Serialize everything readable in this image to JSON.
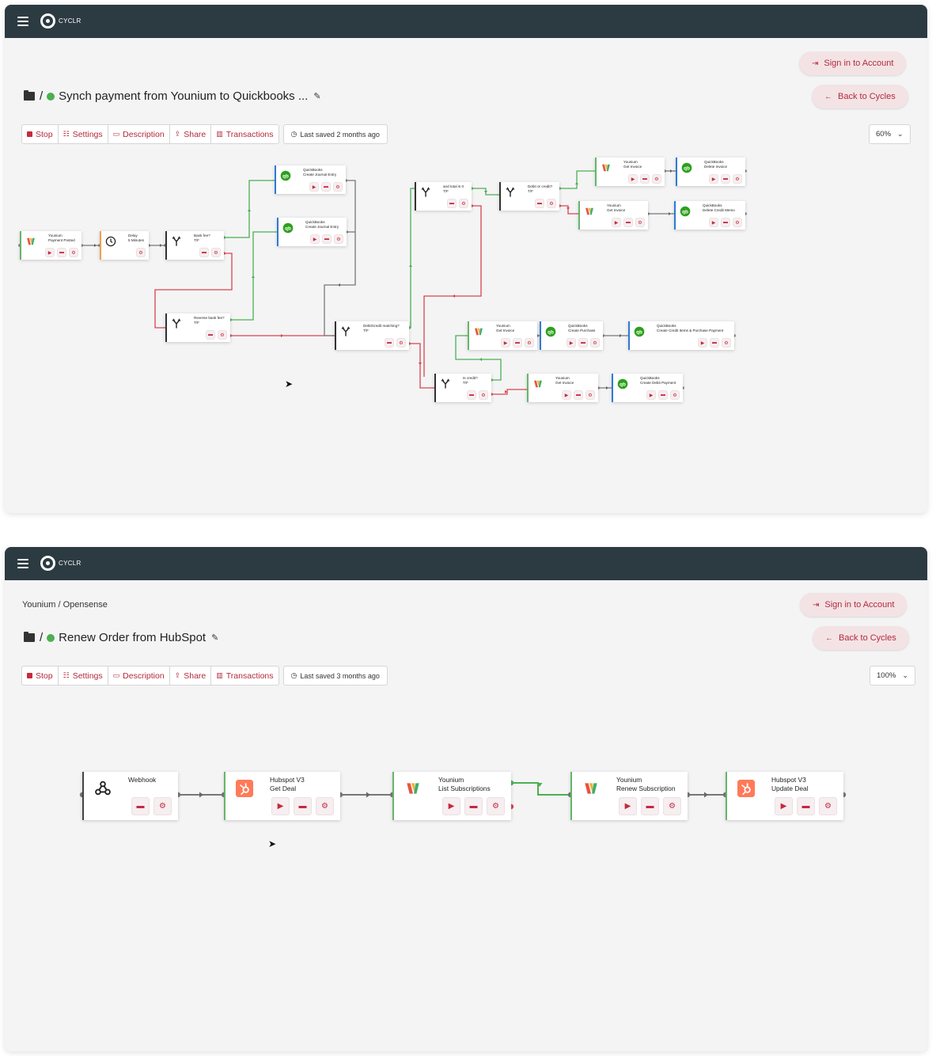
{
  "colors": {
    "topbar": "#2c3a42",
    "accent": "#b22a3c",
    "success": "#4caf50",
    "failure": "#d9434f",
    "quickbooks": "#2ca01c",
    "hubspot": "#ff7a59"
  },
  "app": {
    "logo_text": "CYCLR"
  },
  "screen1": {
    "sign_in": "Sign in to Account",
    "back": "Back to Cycles",
    "title": "Synch payment from Younium to Quickbooks ...",
    "toolbar": {
      "stop": "Stop",
      "settings": "Settings",
      "description": "Description",
      "share": "Share",
      "transactions": "Transactions"
    },
    "last_saved": "Last saved 2 months ago",
    "zoom": "60%",
    "nodes": [
      {
        "line1": "Younium",
        "line2": "Payment Posted",
        "icon": "younium-icon"
      },
      {
        "line1": "Delay",
        "line2": "5 Minutes",
        "icon": "clock-icon"
      },
      {
        "line1": "Bank fee?",
        "line2": "T/F",
        "icon": "fork-icon"
      },
      {
        "line1": "QuickBooks",
        "line2": "Create Journal Entry",
        "icon": "quickbooks-icon"
      },
      {
        "line1": "QuickBooks",
        "line2": "Create Journal Entry",
        "icon": "quickbooks-icon"
      },
      {
        "line1": "Reverse bank fee?",
        "line2": "T/F",
        "icon": "fork-icon"
      },
      {
        "line1": "Debit/credit matching?",
        "line2": "T/F",
        "icon": "fork-icon"
      },
      {
        "line1": "and total is 0",
        "line2": "T/F",
        "icon": "fork-icon"
      },
      {
        "line1": "Debit or credit?",
        "line2": "T/F",
        "icon": "fork-icon"
      },
      {
        "line1": "Younium",
        "line2": "Get Invoice",
        "icon": "younium-icon"
      },
      {
        "line1": "QuickBooks",
        "line2": "Delete Invoice",
        "icon": "quickbooks-icon"
      },
      {
        "line1": "Younium",
        "line2": "Get Invoice",
        "icon": "younium-icon"
      },
      {
        "line1": "QuickBooks",
        "line2": "Delete Credit Memo",
        "icon": "quickbooks-icon"
      },
      {
        "line1": "Younium",
        "line2": "Get Invoice",
        "icon": "younium-icon"
      },
      {
        "line1": "QuickBooks",
        "line2": "Create Purchase",
        "icon": "quickbooks-icon"
      },
      {
        "line1": "QuickBooks",
        "line2": "Create Credit Items & Purchase Payment",
        "icon": "quickbooks-icon"
      },
      {
        "line1": "Is credit?",
        "line2": "T/F",
        "icon": "fork-icon"
      },
      {
        "line1": "Younium",
        "line2": "Get Invoice",
        "icon": "younium-icon"
      },
      {
        "line1": "QuickBooks",
        "line2": "Create Debit Payment",
        "icon": "quickbooks-icon"
      }
    ]
  },
  "screen2": {
    "breadcrumb": "Younium / Opensense",
    "sign_in": "Sign in to Account",
    "back": "Back to Cycles",
    "title": "Renew Order from HubSpot",
    "toolbar": {
      "stop": "Stop",
      "settings": "Settings",
      "description": "Description",
      "share": "Share",
      "transactions": "Transactions"
    },
    "last_saved": "Last saved 3 months ago",
    "zoom": "100%",
    "nodes": [
      {
        "line1": "Webhook",
        "line2": "",
        "icon": "webhook-icon"
      },
      {
        "line1": "Hubspot V3",
        "line2": "Get Deal",
        "icon": "hubspot-icon"
      },
      {
        "line1": "Younium",
        "line2": "List Subscriptions",
        "icon": "younium-icon"
      },
      {
        "line1": "Younium",
        "line2": "Renew Subscription",
        "icon": "younium-icon"
      },
      {
        "line1": "Hubspot V3",
        "line2": "Update Deal",
        "icon": "hubspot-icon"
      }
    ]
  }
}
